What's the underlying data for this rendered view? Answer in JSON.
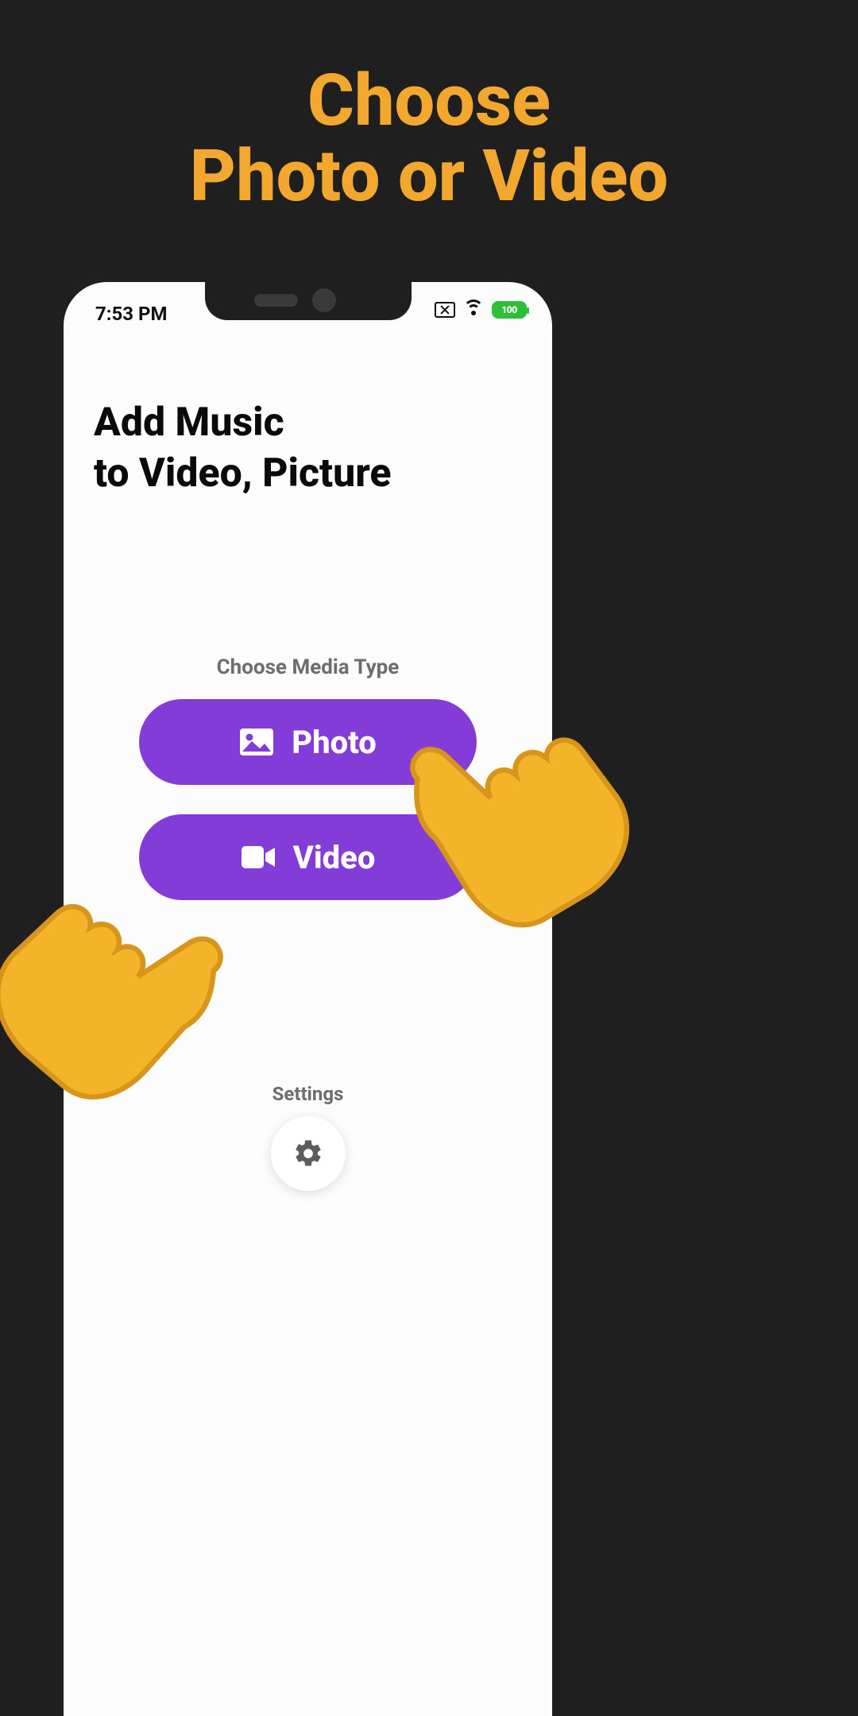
{
  "promo": {
    "line1": "Choose",
    "line2": "Photo or Video"
  },
  "statusbar": {
    "time": "7:53 PM",
    "battery_text": "100"
  },
  "app": {
    "title_line1": "Add Music",
    "title_line2": "to Video, Picture",
    "media_section_label": "Choose Media Type",
    "photo_button_label": "Photo",
    "video_button_label": "Video",
    "settings_label": "Settings"
  },
  "colors": {
    "accent_orange": "#f2a82e",
    "button_purple": "#833cd8",
    "battery_green": "#2bbf3a"
  }
}
